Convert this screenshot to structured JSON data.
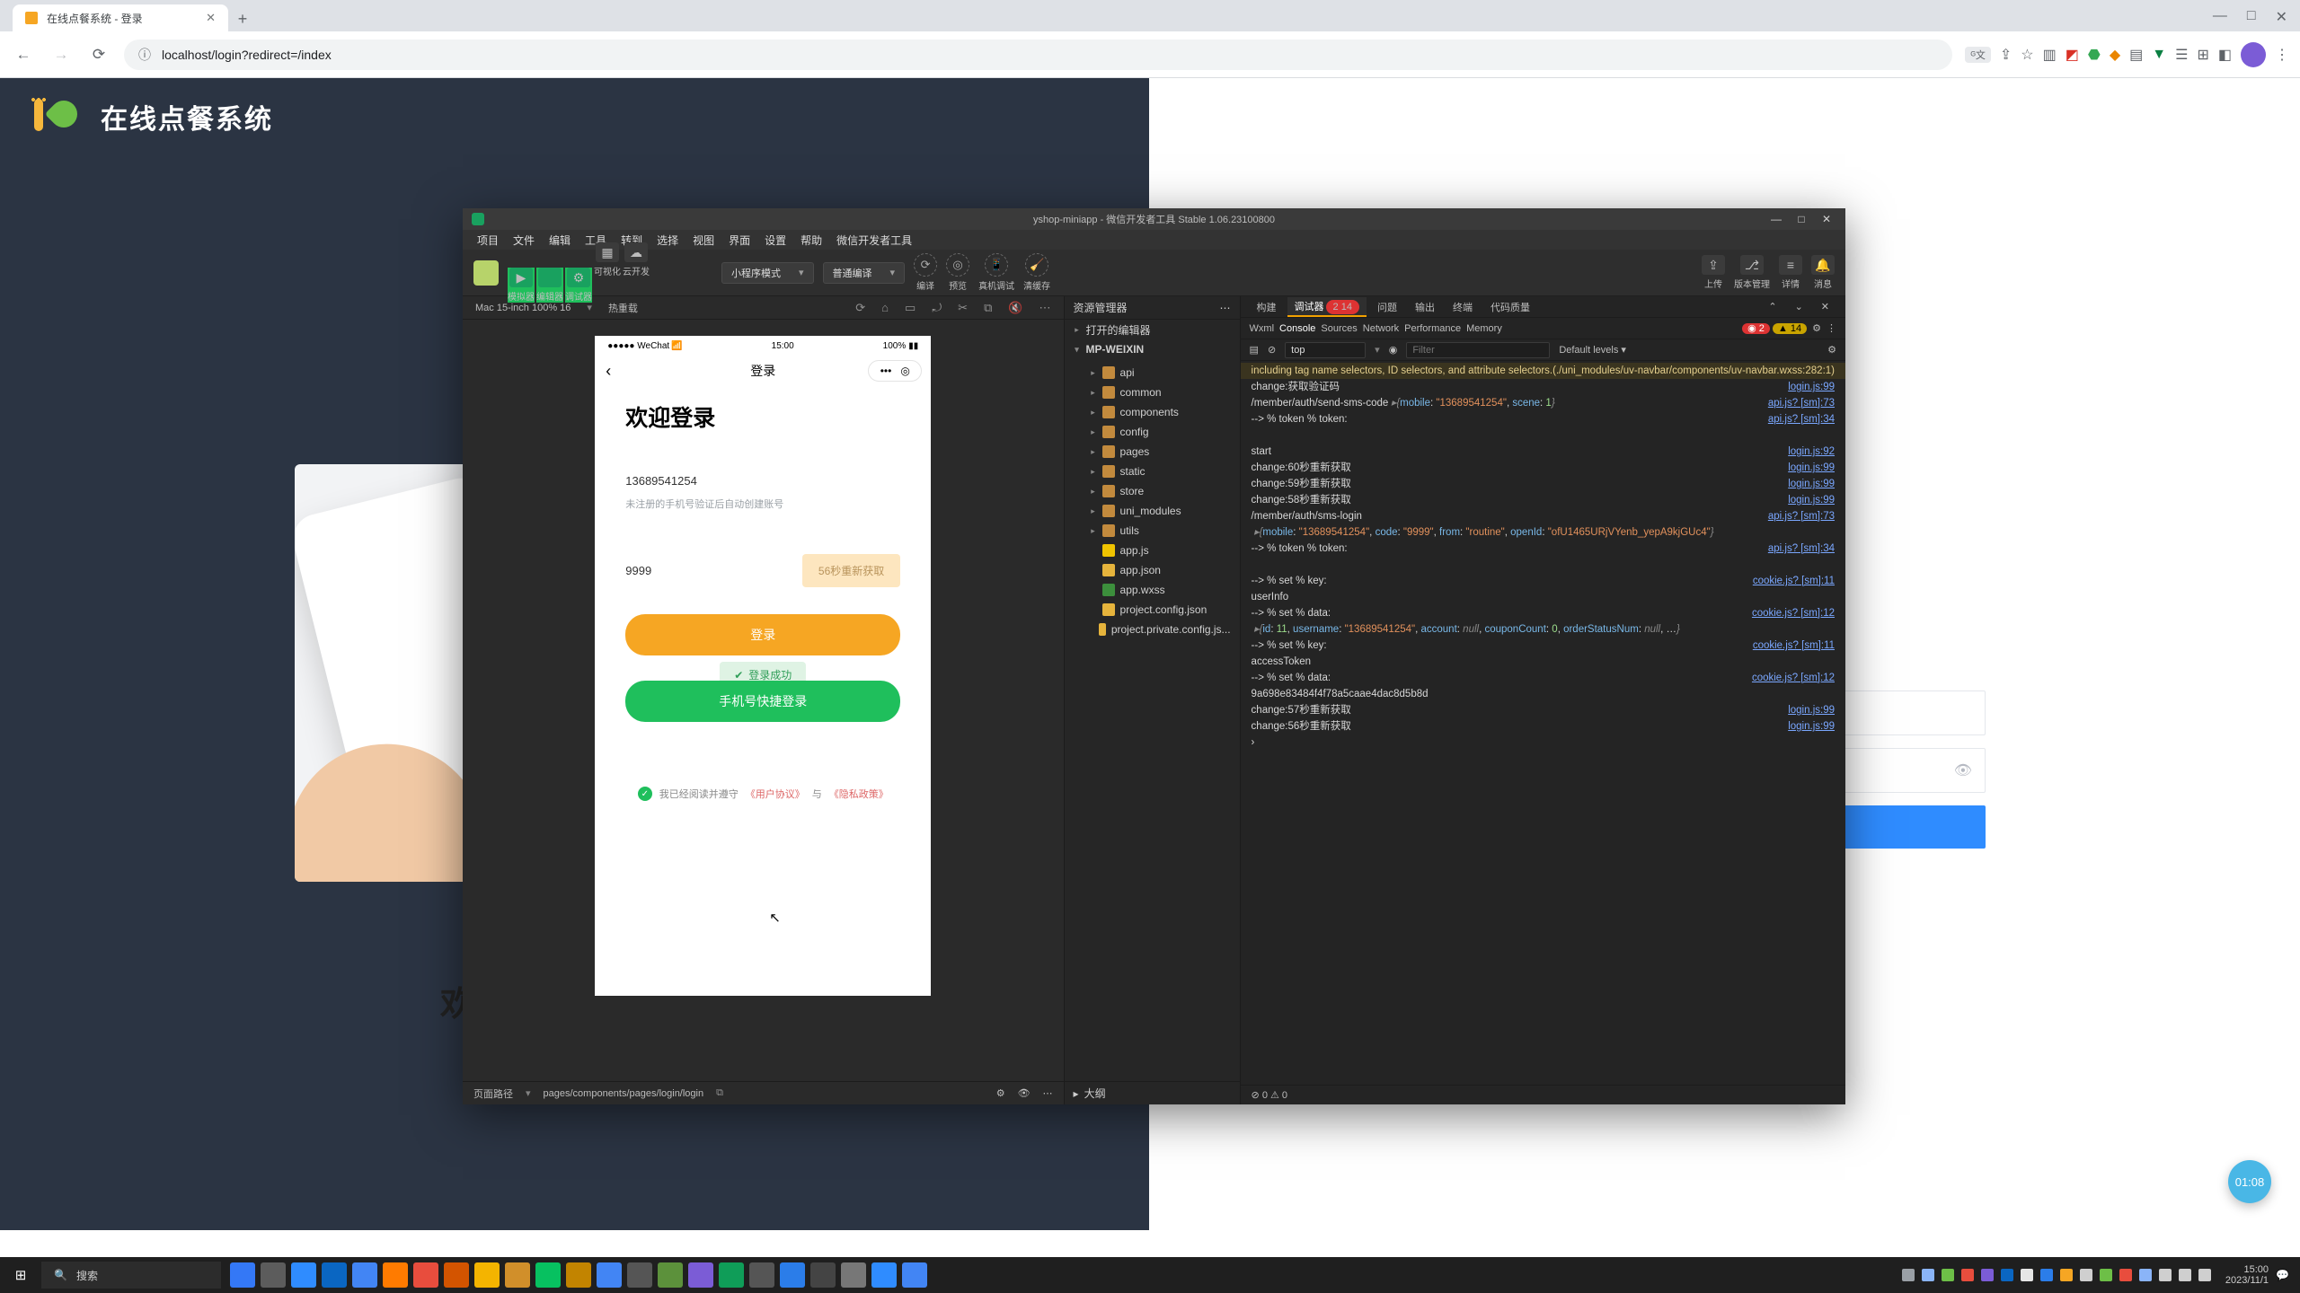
{
  "browser": {
    "tab_title": "在线点餐系统 - 登录",
    "url": "localhost/login?redirect=/index"
  },
  "page": {
    "brand": "在线点餐系统",
    "welcome_truncated": "欢"
  },
  "ide": {
    "title_left": "yshop-miniapp",
    "title_right": "微信开发者工具 Stable 1.06.23100800",
    "menus": [
      "项目",
      "文件",
      "编辑",
      "工具",
      "转到",
      "选择",
      "视图",
      "界面",
      "设置",
      "帮助",
      "微信开发者工具"
    ],
    "toolbar": {
      "groups": [
        "模拟器",
        "编辑器",
        "调试器",
        "可视化",
        "云开发"
      ],
      "mode": "小程序模式",
      "compile": "普通编译",
      "right_labels": [
        "编译",
        "预览",
        "真机调试",
        "清缓存"
      ],
      "far_labels": [
        "上传",
        "版本管理",
        "详情",
        "消息"
      ]
    },
    "sim": {
      "device": "Mac 15-inch 100% 16",
      "hot": "热重载",
      "path_label": "页面路径",
      "path": "pages/components/pages/login/login"
    },
    "phone": {
      "carrier": "●●●●● WeChat",
      "time": "15:00",
      "battery": "100%",
      "nav_title": "登录",
      "h1": "欢迎登录",
      "mobile": "13689541254",
      "hint": "未注册的手机号验证后自动创建账号",
      "code": "9999",
      "resend": "56秒重新获取",
      "login_btn": "登录",
      "toast": "登录成功",
      "quick_btn": "手机号快捷登录",
      "agree_pre": "我已经阅读并遵守",
      "agree_user": "《用户协议》",
      "agree_and": "与",
      "agree_priv": "《隐私政策》"
    },
    "explorer": {
      "header": "资源管理器",
      "open_editors": "打开的编辑器",
      "root": "MP-WEIXIN",
      "items": [
        {
          "t": "folder",
          "n": "api"
        },
        {
          "t": "folder",
          "n": "common"
        },
        {
          "t": "folder",
          "n": "components"
        },
        {
          "t": "folder",
          "n": "config"
        },
        {
          "t": "folder",
          "n": "pages"
        },
        {
          "t": "folder",
          "n": "static"
        },
        {
          "t": "folder",
          "n": "store"
        },
        {
          "t": "folder",
          "n": "uni_modules"
        },
        {
          "t": "folder",
          "n": "utils"
        },
        {
          "t": "js",
          "n": "app.js"
        },
        {
          "t": "json",
          "n": "app.json"
        },
        {
          "t": "wxss",
          "n": "app.wxss"
        },
        {
          "t": "json",
          "n": "project.config.json"
        },
        {
          "t": "json",
          "n": "project.private.config.js..."
        }
      ],
      "outline": "大纲"
    },
    "devtools": {
      "tabs": [
        "构建",
        "调试器",
        "问题",
        "输出",
        "终端",
        "代码质量"
      ],
      "active_tab": "调试器",
      "badge": "2 14",
      "subtabs": [
        "Wxml",
        "Console",
        "Sources",
        "Network",
        "Performance",
        "Memory"
      ],
      "active_sub": "Console",
      "err_count": "2",
      "warn_count": "14",
      "ctx": "top",
      "filter_ph": "Filter",
      "levels": "Default levels",
      "status": "⊘ 0  ⚠ 0"
    }
  },
  "console_lines": [
    {
      "kind": "warn",
      "msg": "including tag name selectors, ID selectors, and attribute selectors.(./uni_modules/uv-navbar/components/uv-navbar.wxss:282:1)",
      "src": ""
    },
    {
      "kind": "log",
      "msg": "change:获取验证码",
      "src": "login.js:99"
    },
    {
      "kind": "log",
      "pairs": [
        [
          "",
          "/member/auth/send-sms-code "
        ],
        [
          "obj",
          "▸{"
        ],
        [
          "prop",
          "mobile"
        ],
        [
          "",
          ": "
        ],
        [
          "str",
          "\"13689541254\""
        ],
        [
          "",
          ", "
        ],
        [
          "prop",
          "scene"
        ],
        [
          "",
          ": "
        ],
        [
          "num",
          "1"
        ],
        [
          "obj",
          "}"
        ]
      ],
      "src": "api.js? [sm]:73"
    },
    {
      "kind": "log",
      "msg": "--> % token % token:",
      "src": "api.js? [sm]:34"
    },
    {
      "kind": "blank"
    },
    {
      "kind": "log",
      "msg": "start",
      "src": "login.js:92"
    },
    {
      "kind": "log",
      "msg": "change:60秒重新获取",
      "src": "login.js:99"
    },
    {
      "kind": "log",
      "msg": "change:59秒重新获取",
      "src": "login.js:99"
    },
    {
      "kind": "log",
      "msg": "change:58秒重新获取",
      "src": "login.js:99"
    },
    {
      "kind": "log",
      "pairs": [
        [
          "",
          "/member/auth/sms-login"
        ]
      ],
      "src": "api.js? [sm]:73"
    },
    {
      "kind": "log",
      "pairs": [
        [
          "obj",
          " ▸{"
        ],
        [
          "prop",
          "mobile"
        ],
        [
          "",
          ": "
        ],
        [
          "str",
          "\"13689541254\""
        ],
        [
          "",
          ", "
        ],
        [
          "prop",
          "code"
        ],
        [
          "",
          ": "
        ],
        [
          "str",
          "\"9999\""
        ],
        [
          "",
          ", "
        ],
        [
          "prop",
          "from"
        ],
        [
          "",
          ": "
        ],
        [
          "str",
          "\"routine\""
        ],
        [
          "",
          ", "
        ],
        [
          "prop",
          "openId"
        ],
        [
          "",
          ": "
        ],
        [
          "str",
          "\"ofU1465URjVYenb_yepA9kjGUc4\""
        ],
        [
          "obj",
          "}"
        ]
      ],
      "src": ""
    },
    {
      "kind": "log",
      "msg": "--> % token % token:",
      "src": "api.js? [sm]:34"
    },
    {
      "kind": "blank"
    },
    {
      "kind": "log",
      "msg": "--> % set % key:",
      "src": "cookie.js? [sm]:11"
    },
    {
      "kind": "log",
      "msg": "userInfo",
      "src": ""
    },
    {
      "kind": "log",
      "msg": "--> % set % data:",
      "src": "cookie.js? [sm]:12"
    },
    {
      "kind": "log",
      "pairs": [
        [
          "obj",
          " ▸{"
        ],
        [
          "prop",
          "id"
        ],
        [
          "",
          ": "
        ],
        [
          "num",
          "11"
        ],
        [
          "",
          ", "
        ],
        [
          "prop",
          "username"
        ],
        [
          "",
          ": "
        ],
        [
          "str",
          "\"13689541254\""
        ],
        [
          "",
          ", "
        ],
        [
          "prop",
          "account"
        ],
        [
          "",
          ": "
        ],
        [
          "dim",
          "null"
        ],
        [
          "",
          ", "
        ],
        [
          "prop",
          "couponCount"
        ],
        [
          "",
          ": "
        ],
        [
          "num",
          "0"
        ],
        [
          "",
          ", "
        ],
        [
          "prop",
          "orderStatusNum"
        ],
        [
          "",
          ": "
        ],
        [
          "dim",
          "null"
        ],
        [
          "",
          ", …"
        ],
        [
          "obj",
          "}"
        ]
      ],
      "src": ""
    },
    {
      "kind": "log",
      "msg": "--> % set % key:",
      "src": "cookie.js? [sm]:11"
    },
    {
      "kind": "log",
      "msg": "accessToken",
      "src": ""
    },
    {
      "kind": "log",
      "msg": "--> % set % data:",
      "src": "cookie.js? [sm]:12"
    },
    {
      "kind": "log",
      "msg": "9a698e83484f4f78a5caae4dac8d5b8d",
      "src": ""
    },
    {
      "kind": "log",
      "msg": "change:57秒重新获取",
      "src": "login.js:99"
    },
    {
      "kind": "log",
      "msg": "change:56秒重新获取",
      "src": "login.js:99"
    },
    {
      "kind": "prompt",
      "msg": "›",
      "src": ""
    }
  ],
  "float_badge": "01:08",
  "taskbar": {
    "search": "搜索",
    "time": "15:00",
    "date": "2023/11/1"
  },
  "task_colors": [
    "#3478f6",
    "#5c5c5c",
    "#2f8cff",
    "#0a66c2",
    "#4285f4",
    "#ff7b00",
    "#e84d3d",
    "#d35400",
    "#f4b400",
    "#d18f2a",
    "#07c160",
    "#c28400",
    "#4285f4",
    "#555",
    "#5c913b",
    "#7b5cd6",
    "#0f9d58",
    "#555",
    "#2b7de9",
    "#444",
    "#777",
    "#2f8cff",
    "#4285f4"
  ],
  "tray_colors": [
    "#9aa0a6",
    "#8ab4f8",
    "#6dbf47",
    "#e84d3d",
    "#7b5cd6",
    "#0a66c2",
    "#e6e6e6",
    "#2b7de9",
    "#f6a623",
    "#cfcfcf",
    "#6dbf47",
    "#e84d3d",
    "#8ab4f8",
    "#cfcfcf",
    "#cfcfcf",
    "#cfcfcf"
  ]
}
